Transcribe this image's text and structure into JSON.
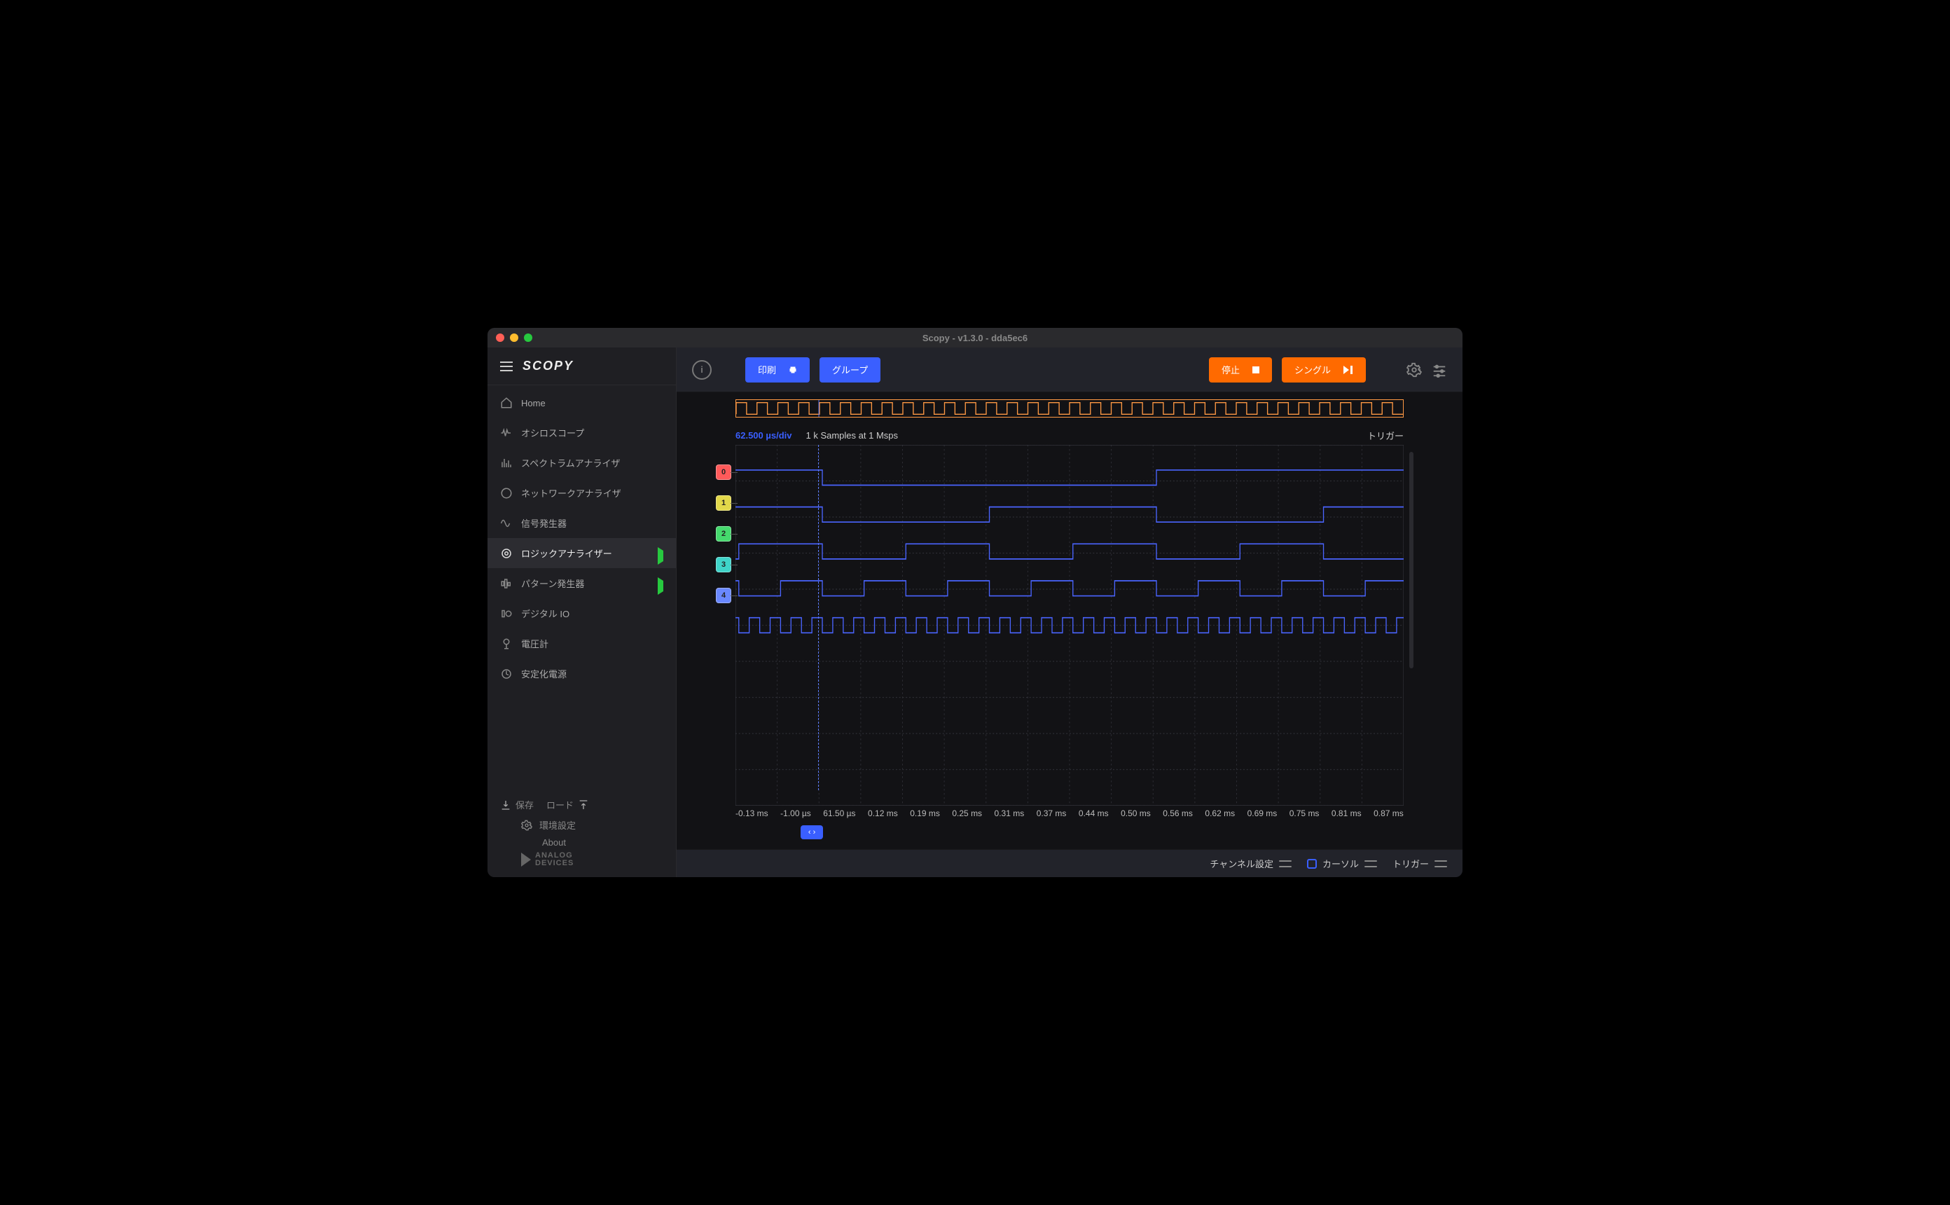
{
  "window": {
    "title": "Scopy - v1.3.0 - dda5ec6"
  },
  "sidebar": {
    "logo": "SCOPY",
    "items": [
      {
        "label": "Home",
        "icon": "home",
        "indicator": ""
      },
      {
        "label": "オシロスコープ",
        "icon": "osc",
        "indicator": "stop"
      },
      {
        "label": "スペクトラムアナライザ",
        "icon": "spec",
        "indicator": "stop"
      },
      {
        "label": "ネットワークアナライザ",
        "icon": "net",
        "indicator": "stop"
      },
      {
        "label": "信号発生器",
        "icon": "siggen",
        "indicator": "stop"
      },
      {
        "label": "ロジックアナライザー",
        "icon": "logic",
        "indicator": "play"
      },
      {
        "label": "パターン発生器",
        "icon": "pattern",
        "indicator": "play"
      },
      {
        "label": "デジタル IO",
        "icon": "dio",
        "indicator": "stop"
      },
      {
        "label": "電圧計",
        "icon": "volt",
        "indicator": "stop"
      },
      {
        "label": "安定化電源",
        "icon": "psu",
        "indicator": "stop"
      }
    ],
    "active_index": 5,
    "footer": {
      "save": "保存",
      "load": "ロード",
      "prefs": "環境設定",
      "about": "About",
      "brand": "ANALOG\nDEVICES"
    }
  },
  "toolbar": {
    "print": "印刷",
    "group": "グループ",
    "stop": "停止",
    "single": "シングル"
  },
  "plot": {
    "timebase": "62.500 µs/div",
    "samples": "1 k Samples at 1 Msps",
    "trigger": "トリガー",
    "cursor_x_frac": 0.124,
    "x_ticks": [
      "-0.13 ms",
      "-1.00 µs",
      "61.50 µs",
      "0.12 ms",
      "0.19 ms",
      "0.25 ms",
      "0.31 ms",
      "0.37 ms",
      "0.44 ms",
      "0.50 ms",
      "0.56 ms",
      "0.62 ms",
      "0.69 ms",
      "0.75 ms",
      "0.81 ms",
      "0.87 ms"
    ],
    "channels": [
      {
        "id": "0",
        "color": "#ff5a5a"
      },
      {
        "id": "1",
        "color": "#e2d84a"
      },
      {
        "id": "2",
        "color": "#45d96d"
      },
      {
        "id": "3",
        "color": "#3fd4c9"
      },
      {
        "id": "4",
        "color": "#6a88ff"
      }
    ],
    "overview_halfperiods": 64,
    "trace_color": "#4a64ff",
    "grid_color": "#2e2f36"
  },
  "bottombar": {
    "channel_settings": "チャンネル設定",
    "cursor": "カーソル",
    "trigger": "トリガー"
  },
  "chart_data": {
    "type": "logic-analyzer",
    "timebase_per_div_us": 62.5,
    "sample_count": 1000,
    "sample_rate_msps": 1,
    "x_range_ms": [
      -0.13,
      0.87
    ],
    "cursor_position_us": -1.0,
    "channels": [
      {
        "name": "0",
        "period_us": 1000,
        "duty": 0.5,
        "phase_us": 0
      },
      {
        "name": "1",
        "period_us": 500,
        "duty": 0.5,
        "phase_us": 0
      },
      {
        "name": "2",
        "period_us": 250,
        "duty": 0.5,
        "phase_us": 0
      },
      {
        "name": "3",
        "period_us": 125,
        "duty": 0.5,
        "phase_us": 0
      },
      {
        "name": "4",
        "period_us": 31.25,
        "duty": 0.5,
        "phase_us": 0
      }
    ]
  }
}
